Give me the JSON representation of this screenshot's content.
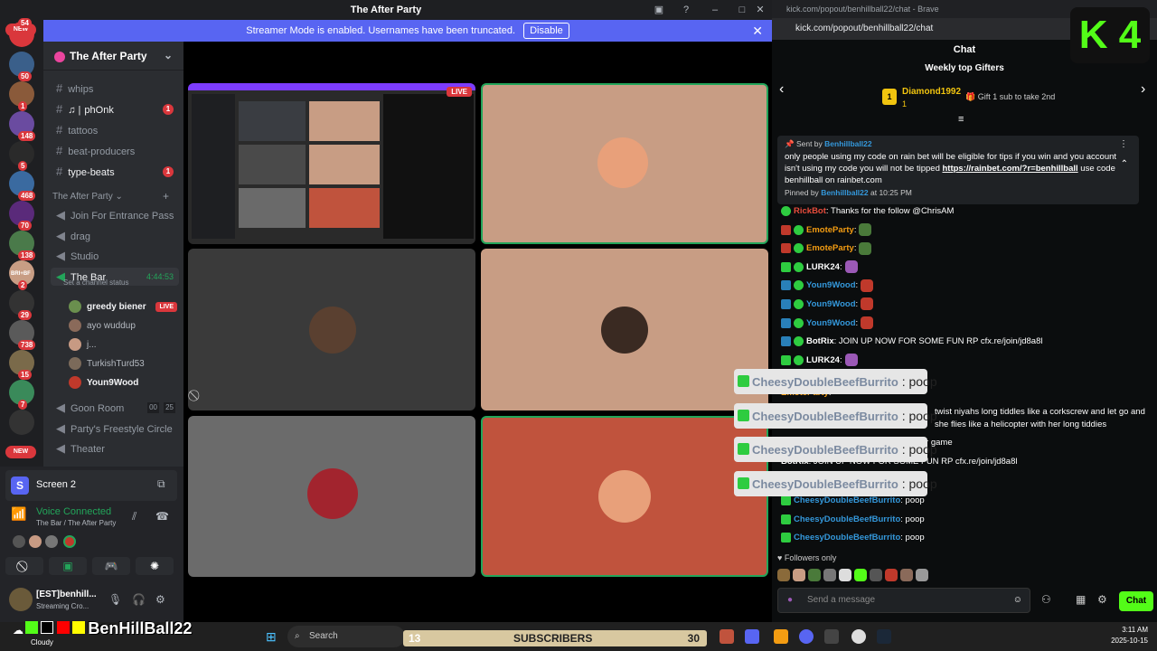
{
  "window": {
    "title": "The After Party"
  },
  "banner": {
    "text": "Streamer Mode is enabled. Usernames have been truncated.",
    "disable": "Disable"
  },
  "server_badges": [
    {
      "n": "54",
      "label": "NEW"
    },
    {
      "n": "50"
    },
    {
      "n": "1"
    },
    {
      "n": "148"
    },
    {
      "n": "5"
    },
    {
      "n": "468"
    },
    {
      "n": "70"
    },
    {
      "n": "138"
    },
    {
      "n": "2"
    },
    {
      "n": "29"
    },
    {
      "n": "738"
    },
    {
      "n": "15"
    },
    {
      "n": "7"
    }
  ],
  "server_new": "NEW",
  "server_tag": "BRI+BF",
  "server": {
    "name": "The After Party"
  },
  "channels": [
    {
      "name": "whips",
      "type": "text"
    },
    {
      "name": "phOnk",
      "type": "text",
      "prefix": "♫ |",
      "badge": "1",
      "white": true
    },
    {
      "name": "tattoos",
      "type": "text"
    },
    {
      "name": "beat-producers",
      "type": "text"
    },
    {
      "name": "type-beats",
      "type": "text",
      "badge": "1",
      "white": true
    }
  ],
  "category": "The After Party",
  "voice_channels": [
    {
      "name": "Join For Entrance Pass"
    },
    {
      "name": "drag"
    },
    {
      "name": "Studio"
    },
    {
      "name": "The Bar",
      "timer": "4:44:53",
      "status": "Set a channel status"
    }
  ],
  "voice_users": [
    {
      "name": "greedy biener",
      "live": "LIVE",
      "white": true,
      "color": "#6a8f4e"
    },
    {
      "name": "ayo wuddup",
      "white": false,
      "color": "#8a6a5a"
    },
    {
      "name": "j...",
      "white": false,
      "color": "#c79a83"
    },
    {
      "name": "TurkishTurd53",
      "white": false,
      "color": "#7b6a5a"
    },
    {
      "name": "Youn9Wood",
      "white": true,
      "color": "#c0392b"
    }
  ],
  "more_voice": [
    {
      "name": "Goon Room",
      "counts": [
        "00",
        "25"
      ]
    },
    {
      "name": "Party's Freestyle Circle"
    },
    {
      "name": "Theater"
    }
  ],
  "screen_panel": {
    "label": "Screen 2"
  },
  "voice": {
    "status": "Voice Connected",
    "location": "The Bar / The After Party"
  },
  "user": {
    "name": "[EST]benhill...",
    "status": "Streaming Cro..."
  },
  "stream_live": "LIVE",
  "browser": {
    "title": "kick.com/popout/benhillball22/chat - Brave",
    "url": "kick.com/popout/benhillball22/chat"
  },
  "chat": {
    "header": "Chat",
    "gifters_title": "Weekly top Gifters",
    "top_gifter": {
      "rank": "1",
      "name": "Diamond1992",
      "count": "1"
    },
    "gift_cta": "Gift 1 sub to take 2nd",
    "pinned": {
      "sent_by": "Sent by",
      "author": "Benhillball22",
      "text": "only people using my code on rain bet will be eligible for tips if you win and you account isn't using my code you will not be tipped ",
      "link": "https://rainbet.com/?r=benhillball",
      "text2": " use code benhillball on rainbet.com",
      "pinned_by": "Pinned by",
      "pinner": "Benhillball22",
      "time": "at 10:25 PM"
    },
    "messages": [
      {
        "user": "RickBot",
        "text": " Thanks for the follow @ChrisAM",
        "color": "#e74c3c"
      },
      {
        "user": "EmoteParty",
        "text": "",
        "emote": "#4a7a3a",
        "color": "#f39c12",
        "badge": "#c0392b"
      },
      {
        "user": "EmoteParty",
        "text": "",
        "emote": "#4a7a3a",
        "color": "#f39c12",
        "badge": "#c0392b"
      },
      {
        "user": "LURK24",
        "text": "",
        "emote": "#9b59b6",
        "color": "#ffffff",
        "badge": "#2ecc40"
      },
      {
        "user": "Youn9Wood",
        "text": "",
        "emote": "#c0392b",
        "color": "#3498db",
        "badge": "#2980b9"
      },
      {
        "user": "Youn9Wood",
        "text": "",
        "emote": "#c0392b",
        "color": "#3498db",
        "badge": "#2980b9"
      },
      {
        "user": "Youn9Wood",
        "text": "",
        "emote": "#c0392b",
        "color": "#3498db",
        "badge": "#2980b9"
      },
      {
        "user": "BotRix",
        "text": " JOIN UP NOW FOR SOME FUN RP cfx.re/join/jd8a8l",
        "color": "#ffffff",
        "badge": "#2980b9"
      },
      {
        "user": "LURK24",
        "text": "",
        "emote": "#9b59b6",
        "color": "#ffffff",
        "badge": "#2ecc40"
      }
    ],
    "messages_mid": [
      {
        "user": "EmoteParty",
        "text": "",
        "color": "#f39c12"
      },
      {
        "text": "twist niyahs long tiddles like a corkscrew and let go and"
      },
      {
        "text": "she flies like a helicopter with her long tiddies"
      },
      {
        "text": "car game"
      },
      {
        "user": "BotRix",
        "text": " JOIN UP NOW FOR SOME FUN RP cfx.re/join/jd8a8l",
        "color": "#ffffff"
      }
    ],
    "messages_bottom": [
      {
        "user": "CheesyDoubleBeefBurrito",
        "text": " poop",
        "color": "#3498db"
      },
      {
        "user": "CheesyDoubleBeefBurrito",
        "text": " poop",
        "color": "#3498db"
      },
      {
        "user": "CheesyDoubleBeefBurrito",
        "text": " poop",
        "color": "#3498db"
      }
    ],
    "followers_only": "Followers only",
    "send_placeholder": "Send a message",
    "send_button": "Chat"
  },
  "popups": [
    {
      "name": "CheesyDoubleBeefBurrito",
      "text": " : poop"
    },
    {
      "name": "CheesyDoubleBeefBurrito",
      "text": " : poop"
    },
    {
      "name": "CheesyDoubleBeefBurrito",
      "text": " : poop"
    },
    {
      "name": "CheesyDoubleBeefBurrito",
      "text": " : poop"
    }
  ],
  "overlay": {
    "channel": "BenHillBall22",
    "logo": "K 4"
  },
  "taskbar": {
    "weather": "Cloudy",
    "search": "Search",
    "subs_label": "SUBSCRIBERS",
    "subs_left": "13",
    "subs_right": "30",
    "time": "3:11 AM",
    "date": "2025-10-15"
  },
  "colors": {
    "discord_bg": "#1e1f22",
    "accent": "#5865f2",
    "kick_green": "#53fc18",
    "live_red": "#da373c"
  }
}
